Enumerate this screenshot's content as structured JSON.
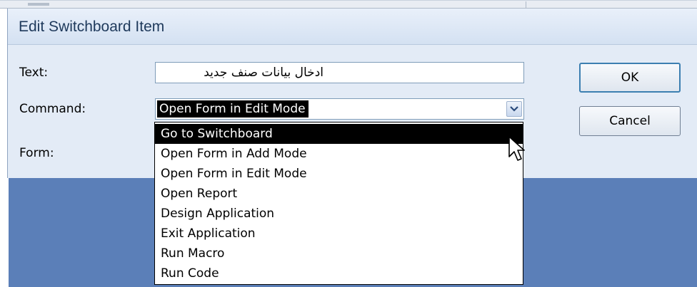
{
  "dialog": {
    "title": "Edit Switchboard Item",
    "text_label": "Text:",
    "text_value": "ادخال بيانات صنف جديد",
    "command_label": "Command:",
    "command_value": "Open Form in Edit Mode",
    "form_label": "Form:",
    "ok_label": "OK",
    "cancel_label": "Cancel"
  },
  "dropdown": {
    "items": [
      "Go to Switchboard",
      "Open Form in Add Mode",
      "Open Form in Edit Mode",
      "Open Report",
      "Design Application",
      "Exit Application",
      "Run Macro",
      "Run Code"
    ],
    "highlighted": "Go to Switchboard"
  },
  "icons": {
    "dropdown_button": "chevron-down-icon",
    "pointer": "mouse-pointer-icon"
  },
  "colors": {
    "dialog_bg": "#e3ebf6",
    "backdrop": "#5b7fb8",
    "title_text": "#1e395b",
    "selection_bg": "#000000"
  }
}
